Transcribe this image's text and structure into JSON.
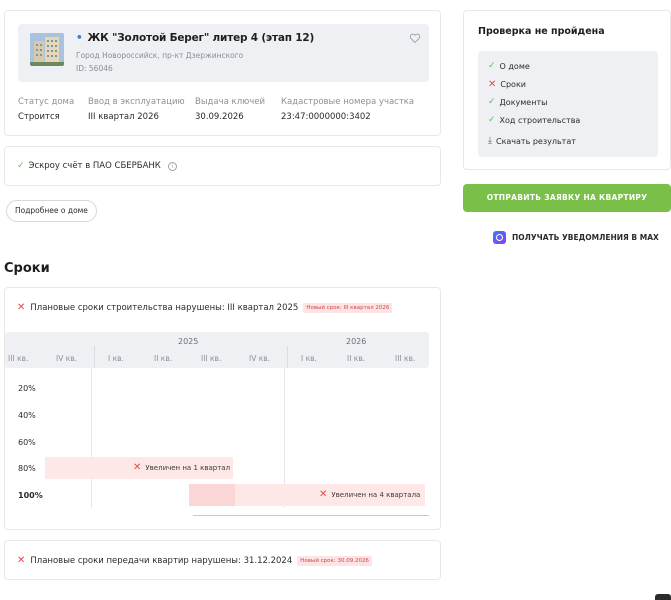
{
  "house": {
    "title": "ЖК \"Золотой Берег\" литер 4 (этап 12)",
    "address": "Город Новороссийск, пр-кт Дзержинского",
    "id": "ID: 56046"
  },
  "info": [
    {
      "label": "Статус дома",
      "value": "Строится"
    },
    {
      "label": "Ввод в эксплуатацию",
      "value": "III квартал 2026"
    },
    {
      "label": "Выдача ключей",
      "value": "30.09.2026"
    },
    {
      "label": "Кадастровые номера участка",
      "value": "23:47:0000000:3402"
    }
  ],
  "escrow": {
    "text": "Эскроу счёт в ПАО СБЕРБАНК",
    "info_glyph": "i"
  },
  "more_button": "Подробнее о доме",
  "section_title": "Сроки",
  "timeline": {
    "heading": "Плановые сроки строительства нарушены: III квартал 2025",
    "badge": "Новый срок: III квартал 2026",
    "years": [
      "2025",
      "2026"
    ],
    "quarters": [
      "III кв.",
      "IV кв.",
      "I кв.",
      "II кв.",
      "III кв.",
      "IV кв.",
      "I кв.",
      "II кв.",
      "III кв."
    ],
    "percents": [
      "20%",
      "40%",
      "60%",
      "80%",
      "100%"
    ],
    "bar_80_label": "Увеличен на 1 квартал",
    "bar_100_label": "Увеличен на 4 квартала"
  },
  "transfer": {
    "heading": "Плановые сроки передачи квартир нарушены: 31.12.2024",
    "badge": "Новый срок: 30.09.2026"
  },
  "check": {
    "title": "Проверка не пройдена",
    "items": [
      {
        "label": "О доме",
        "status": "ok"
      },
      {
        "label": "Сроки",
        "status": "fail"
      },
      {
        "label": "Документы",
        "status": "ok"
      },
      {
        "label": "Ход строительства",
        "status": "ok"
      }
    ],
    "download": "Скачать результат"
  },
  "apply_button": "ОТПРАВИТЬ ЗАЯВКУ НА КВАРТИРУ",
  "notify_text": "ПОЛУЧАТЬ УВЕДОМЛЕНИЯ В MAX",
  "colors": {
    "accent_green": "#79bf48",
    "error_red": "#e24b4b",
    "ok_green": "#5bbd5b",
    "panel_gray": "#eef0f3"
  }
}
